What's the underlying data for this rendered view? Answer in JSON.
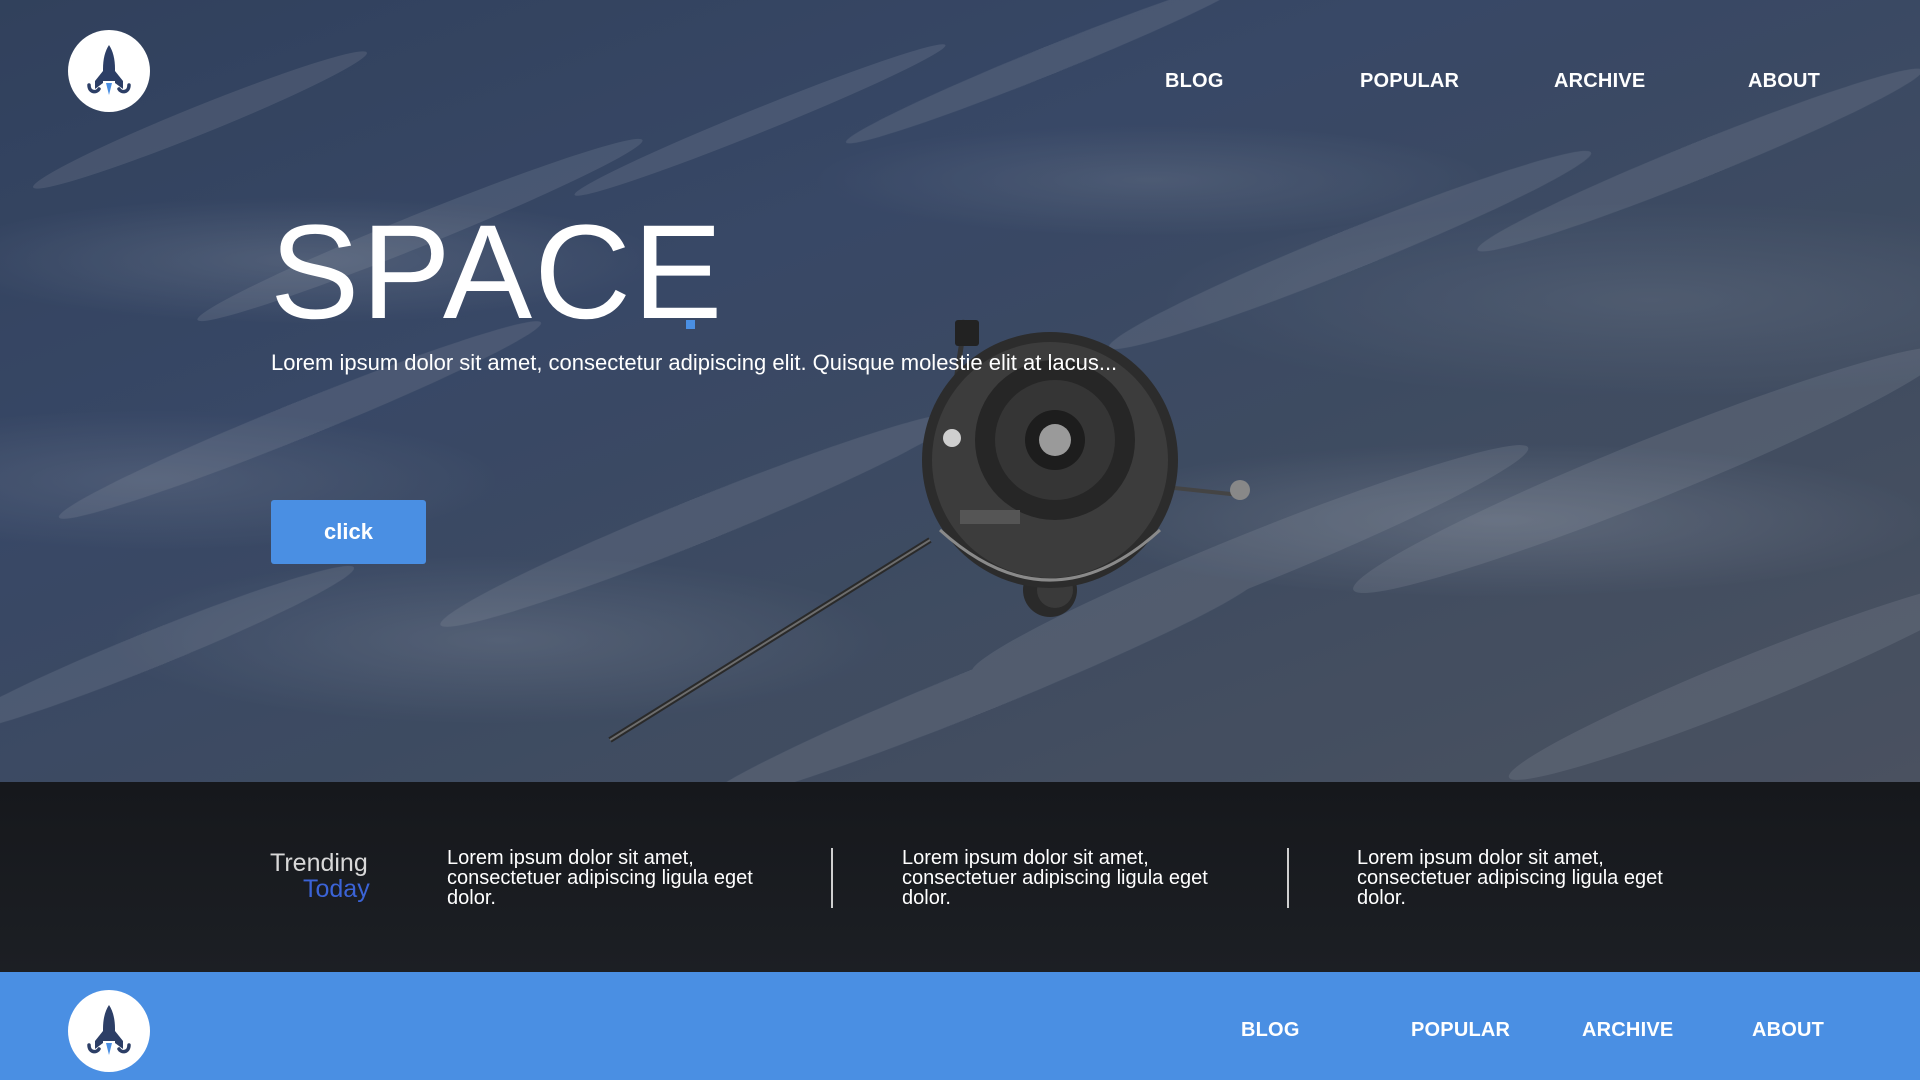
{
  "header": {
    "logo_icon": "rocket-logo-icon",
    "nav": [
      "BLOG",
      "POPULAR",
      "ARCHIVE",
      "ABOUT"
    ]
  },
  "hero": {
    "title": "SPACE",
    "subtitle": "Lorem ipsum dolor sit amet, consectetur adipiscing elit. Quisque molestie elit at lacus...",
    "button_label": "click",
    "accent_color": "#4a8fe3"
  },
  "trending": {
    "label_line1": "Trending",
    "label_line2": "Today",
    "items": [
      "Lorem ipsum dolor sit amet, consectetuer adipiscing ligula eget dolor.",
      "Lorem ipsum dolor sit amet, consectetuer adipiscing ligula eget dolor.",
      "Lorem ipsum dolor sit amet, consectetuer adipiscing ligula eget dolor."
    ]
  },
  "footer": {
    "logo_icon": "rocket-logo-icon",
    "nav": [
      "BLOG",
      "POPULAR",
      "ARCHIVE",
      "ABOUT"
    ],
    "background_color": "#4a8fe3"
  }
}
